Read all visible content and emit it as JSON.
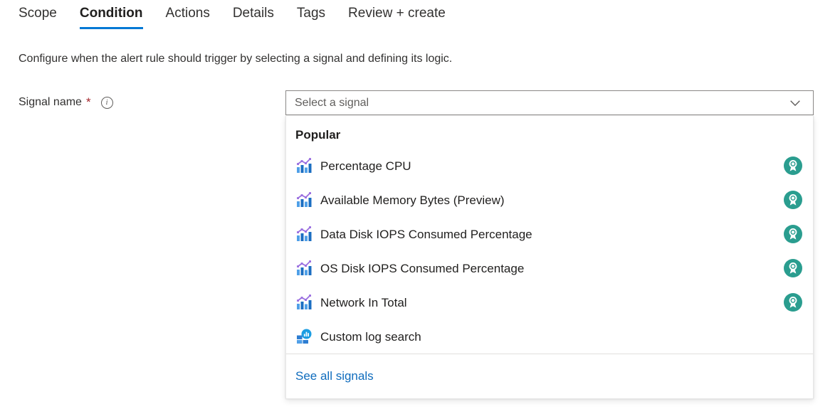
{
  "tabs": [
    {
      "label": "Scope",
      "selected": false
    },
    {
      "label": "Condition",
      "selected": true
    },
    {
      "label": "Actions",
      "selected": false
    },
    {
      "label": "Details",
      "selected": false
    },
    {
      "label": "Tags",
      "selected": false
    },
    {
      "label": "Review + create",
      "selected": false
    }
  ],
  "description": "Configure when the alert rule should trigger by selecting a signal and defining its logic.",
  "form": {
    "signal_name_label": "Signal name",
    "required_marker": "*",
    "info_icon": "info-icon",
    "info_glyph": "i"
  },
  "combo": {
    "placeholder": "Select a signal",
    "value": "",
    "chevron_icon": "chevron-down-icon"
  },
  "dropdown": {
    "group_header": "Popular",
    "items": [
      {
        "label": "Percentage CPU",
        "icon": "metric-chart-icon",
        "badge": "popular-ribbon-icon"
      },
      {
        "label": "Available Memory Bytes (Preview)",
        "icon": "metric-chart-icon",
        "badge": "popular-ribbon-icon"
      },
      {
        "label": "Data Disk IOPS Consumed Percentage",
        "icon": "metric-chart-icon",
        "badge": "popular-ribbon-icon"
      },
      {
        "label": "OS Disk IOPS Consumed Percentage",
        "icon": "metric-chart-icon",
        "badge": "popular-ribbon-icon"
      },
      {
        "label": "Network In Total",
        "icon": "metric-chart-icon",
        "badge": "popular-ribbon-icon"
      },
      {
        "label": "Custom log search",
        "icon": "log-search-icon",
        "badge": ""
      }
    ],
    "footer_link": "See all signals"
  },
  "colors": {
    "accent": "#0078d4",
    "link": "#0f6cbd",
    "required": "#a4262c",
    "badge_teal": "#2a9d8f",
    "icon_blue": "#1b6ec2",
    "icon_light_blue": "#50a0e8",
    "icon_purple": "#9b6fe0",
    "text": "#201f1e",
    "border": "#8a8886"
  }
}
